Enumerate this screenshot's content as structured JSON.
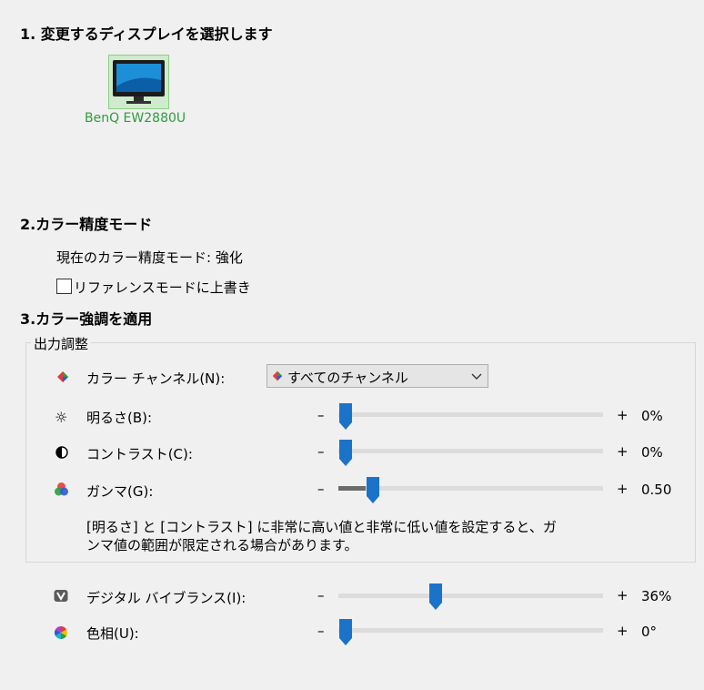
{
  "sections": {
    "select_display": "1. 変更するディスプレイを選択します",
    "color_mode": "2.カラー精度モード",
    "color_enhance": "3.カラー強調を適用"
  },
  "monitor": {
    "name": "BenQ EW2880U"
  },
  "color_mode": {
    "current": "現在のカラー精度モード: 強化",
    "override_label": "リファレンスモードに上書き",
    "override_checked": false
  },
  "output": {
    "group_title": "出力調整",
    "channel_label": "カラー チャンネル(N):",
    "channel_value": "すべてのチャンネル",
    "brightness": {
      "label": "明るさ(B):",
      "value": "0%",
      "level": 0.0
    },
    "contrast": {
      "label": "コントラスト(C):",
      "value": "0%",
      "level": 0.0
    },
    "gamma": {
      "label": "ガンマ(G):",
      "value": "0.50",
      "level": 0.11
    },
    "note_line1": "[明るさ] と [コントラスト] に非常に高い値と非常に低い値を設定すると、ガ",
    "note_line2": "ンマ値の範囲が限定される場合があります。"
  },
  "digital_vibrance": {
    "label": "デジタル バイブランス(I):",
    "value": "36%",
    "level": 0.36
  },
  "hue": {
    "label": "色相(U):",
    "value": "0°",
    "level": 0.0
  },
  "slider": {
    "minus": "–",
    "plus": "+"
  },
  "colors": {
    "accent": "#1a73c9",
    "monitor_label": "#2e9c3c"
  }
}
